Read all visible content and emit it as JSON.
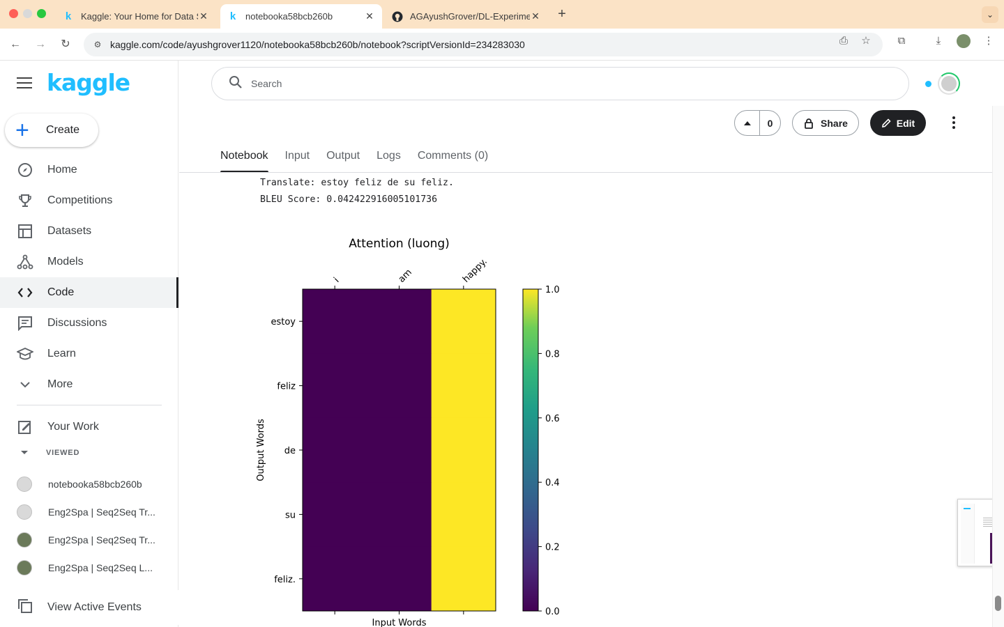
{
  "browser": {
    "tabs": [
      {
        "title": "Kaggle: Your Home for Data S",
        "favicon": "kaggle-k-icon",
        "active": false
      },
      {
        "title": "notebooka58bcb260b",
        "favicon": "kaggle-k-icon",
        "active": true
      },
      {
        "title": "AGAyushGrover/DL-Experime",
        "favicon": "github-icon",
        "active": false
      }
    ],
    "url": "kaggle.com/code/ayushgrover1120/notebooka58bcb260b/notebook?scriptVersionId=234283030"
  },
  "sidebar": {
    "logo": "kaggle",
    "create_label": "Create",
    "nav": [
      {
        "label": "Home",
        "icon": "compass-icon"
      },
      {
        "label": "Competitions",
        "icon": "trophy-icon"
      },
      {
        "label": "Datasets",
        "icon": "table-icon"
      },
      {
        "label": "Models",
        "icon": "models-icon"
      },
      {
        "label": "Code",
        "icon": "code-icon",
        "active": true
      },
      {
        "label": "Discussions",
        "icon": "discussions-icon"
      },
      {
        "label": "Learn",
        "icon": "school-icon"
      },
      {
        "label": "More",
        "icon": "chevron-down-icon"
      }
    ],
    "your_work": "Your Work",
    "viewed_label": "VIEWED",
    "recent": [
      "notebooka58bcb260b",
      "Eng2Spa | Seq2Seq Tr...",
      "Eng2Spa | Seq2Seq Tr...",
      "Eng2Spa | Seq2Seq L..."
    ],
    "view_active_events": "View Active Events"
  },
  "header": {
    "search_placeholder": "Search",
    "vote_count": "0",
    "share_label": "Share",
    "edit_label": "Edit"
  },
  "notebook_tabs": [
    "Notebook",
    "Input",
    "Output",
    "Logs",
    "Comments (0)"
  ],
  "output": {
    "translate_line": "Translate: estoy feliz de su feliz.",
    "bleu_line": "BLEU Score: 0.042422916005101736"
  },
  "chart_data": {
    "type": "heatmap",
    "title": "Attention (luong)",
    "xlabel": "Input Words",
    "ylabel": "Output Words",
    "x_categories": [
      "i",
      "am",
      "happy."
    ],
    "y_categories": [
      "estoy",
      "feliz",
      "de",
      "su",
      "feliz."
    ],
    "values": [
      [
        0,
        0,
        1
      ],
      [
        0,
        0,
        1
      ],
      [
        0,
        0,
        1
      ],
      [
        0,
        0,
        1
      ],
      [
        0,
        0,
        1
      ]
    ],
    "colormap": "viridis",
    "colorbar_range": [
      0.0,
      1.0
    ],
    "colorbar_ticks": [
      "0.0",
      "0.2",
      "0.4",
      "0.6",
      "0.8",
      "1.0"
    ],
    "colors": {
      "low": "#440154",
      "high": "#fde725"
    }
  }
}
